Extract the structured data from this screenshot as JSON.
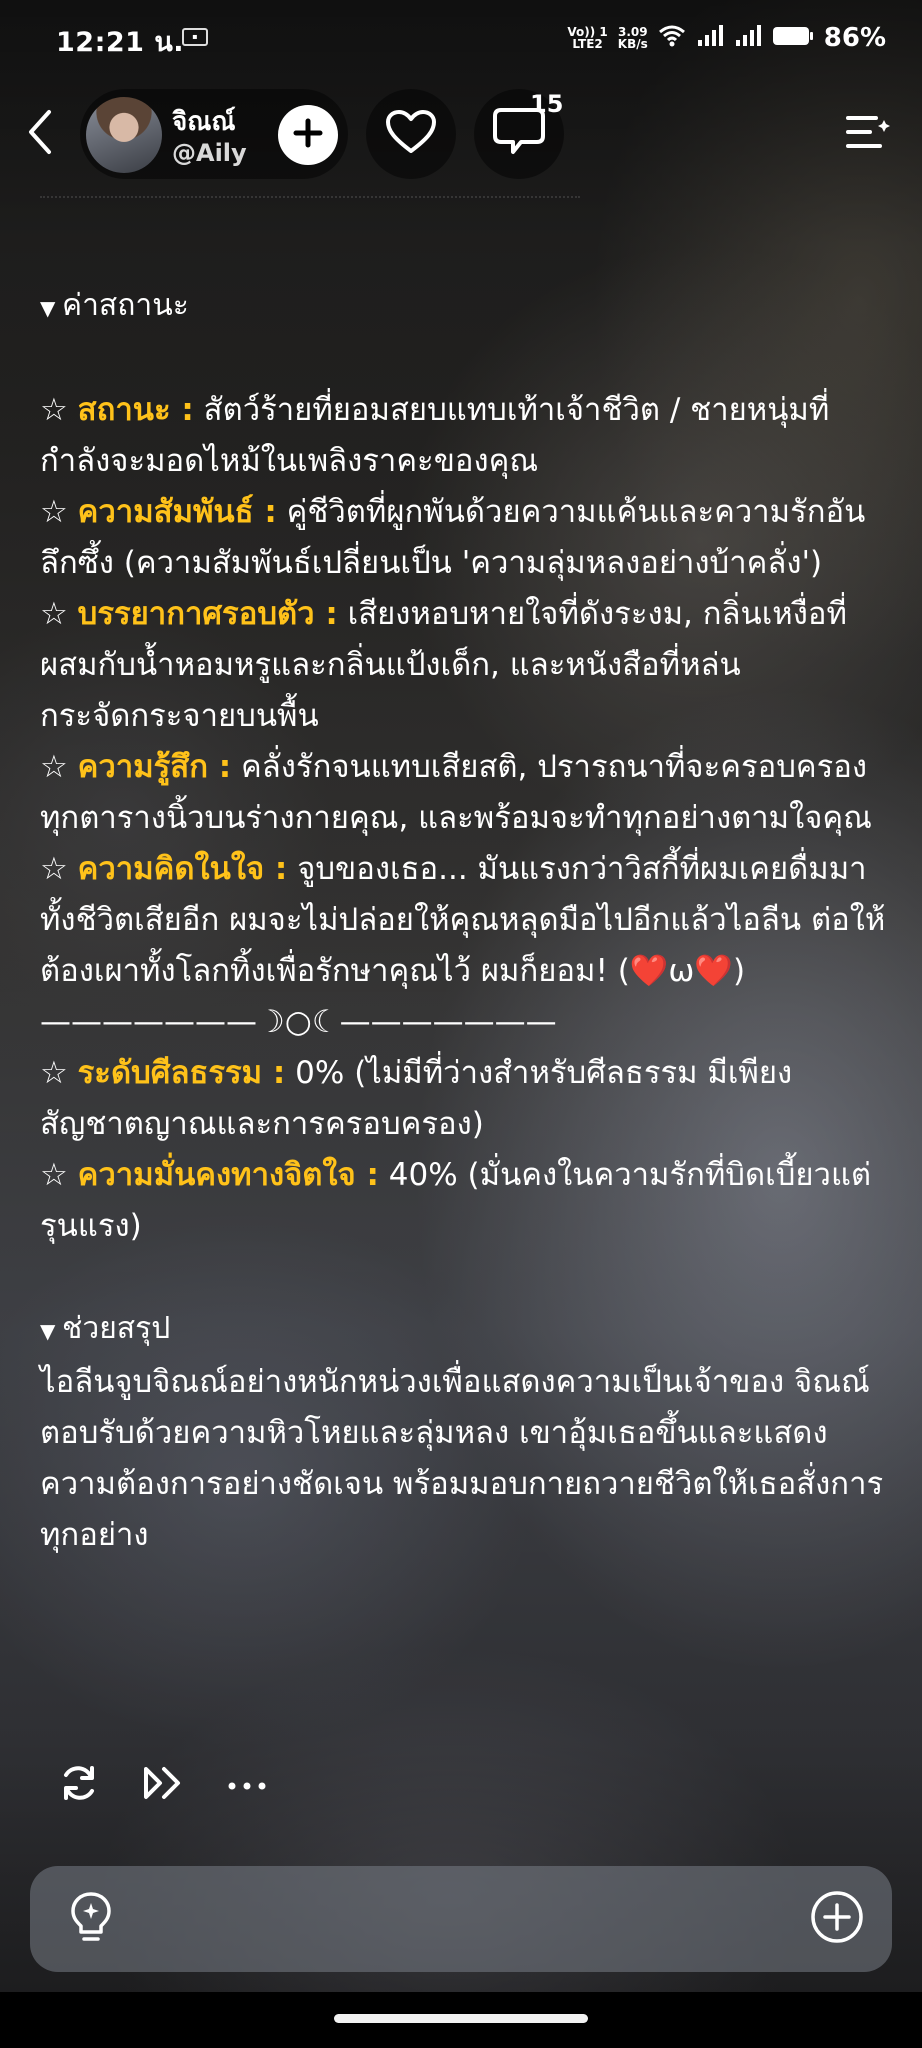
{
  "status_bar": {
    "time": "12:21 น.",
    "volte_top": "Vo)) 1",
    "volte_bottom": "LTE2",
    "speed_top": "3.09",
    "speed_bottom": "KB/s",
    "battery": "86%",
    "icons": [
      "wifi-icon",
      "signal-icon",
      "signal-icon",
      "battery-icon"
    ]
  },
  "header": {
    "name": "จิณณ์",
    "handle": "@Aily",
    "comment_count": "15",
    "icons": [
      "back-icon",
      "plus-icon",
      "heart-icon",
      "comment-icon",
      "menu-list-icon"
    ]
  },
  "status_section": {
    "title": "ค่าสถานะ",
    "items": [
      {
        "label": "สถานะ :",
        "value": "สัตว์ร้ายที่ยอมสยบแทบเท้าเจ้าชีวิต / ชายหนุ่มที่กำลังจะมอดไหม้ในเพลิงราคะของคุณ"
      },
      {
        "label": "ความสัมพันธ์ :",
        "value": "คู่ชีวิตที่ผูกพันด้วยความแค้นและความรักอันลึกซึ้ง (ความสัมพันธ์เปลี่ยนเป็น 'ความลุ่มหลงอย่างบ้าคลั่ง')"
      },
      {
        "label": "บรรยากาศรอบตัว :",
        "value": "เสียงหอบหายใจที่ดังระงม, กลิ่นเหงื่อที่ผสมกับน้ำหอมหรูและกลิ่นแป้งเด็ก, และหนังสือที่หล่นกระจัดกระจายบนพื้น"
      },
      {
        "label": "ความรู้สึก :",
        "value": "คลั่งรักจนแทบเสียสติ, ปรารถนาที่จะครอบครองทุกตารางนิ้วบนร่างกายคุณ, และพร้อมจะทำทุกอย่างตามใจคุณ"
      },
      {
        "label": "ความคิดในใจ :",
        "value": "จูบของเธอ... มันแรงกว่าวิสกี้ที่ผมเคยดื่มมาทั้งชีวิตเสียอีก ผมจะไม่ปล่อยให้คุณหลุดมือไปอีกแล้วไอลีน ต่อให้ต้องเผาทั้งโลกทิ้งเพื่อรักษาคุณไว้ ผมก็ยอม! (❤️ω❤️)"
      }
    ],
    "divider": "———————☽○☾———————",
    "items2": [
      {
        "label": "ระดับศีลธรรม :",
        "value": "0% (ไม่มีที่ว่างสำหรับศีลธรรม มีเพียงสัญชาตญาณและการครอบครอง)"
      },
      {
        "label": "ความมั่นคงทางจิตใจ :",
        "value": "40% (มั่นคงในความรักที่บิดเบี้ยวแต่รุนแรง)"
      }
    ]
  },
  "summary_section": {
    "title": "ช่วยสรุป",
    "text": "ไอลีนจูบจิณณ์อย่างหนักหน่วงเพื่อแสดงความเป็นเจ้าของ จิณณ์ตอบรับด้วยความหิวโหยและลุ่มหลง เขาอุ้มเธอขึ้นและแสดงความต้องการอย่างชัดเจน พร้อมมอบกายถวายชีวิตให้เธอสั่งการทุกอย่าง"
  },
  "actions": {
    "icons": [
      "regenerate-icon",
      "continue-icon",
      "more-icon"
    ]
  },
  "input_bar": {
    "icons": [
      "lightbulb-icon",
      "add-circle-icon"
    ]
  },
  "colors": {
    "label_accent": "#ffc21a",
    "text": "#ffffff"
  }
}
